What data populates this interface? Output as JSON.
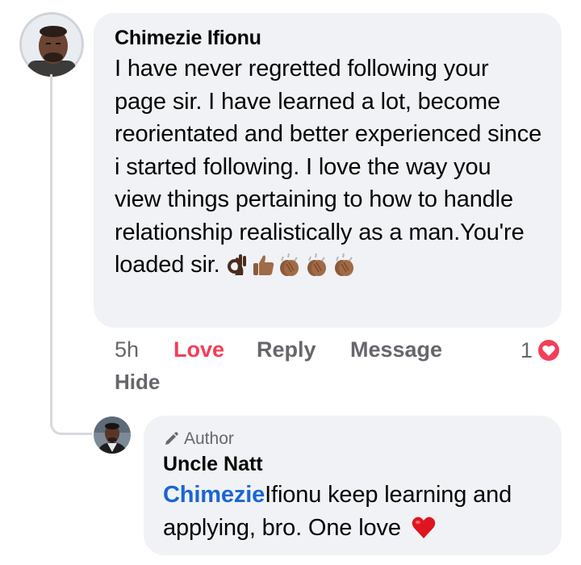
{
  "comment": {
    "author": "Chimezie Ifionu",
    "text": "I have never regretted following your page sir. I have learned a lot, become reorientated and better experienced since i started following. I love the way you view things pertaining to how to handle relationship realistically as a man.You're loaded sir.",
    "emojis": [
      "ok-hand-emoji",
      "thumbs-up-emoji",
      "clapping-hands-emoji",
      "clapping-hands-emoji",
      "clapping-hands-emoji"
    ],
    "time": "5h",
    "love_label": "Love",
    "reply_label": "Reply",
    "message_label": "Message",
    "reaction_count": "1",
    "hide_label": "Hide"
  },
  "reply": {
    "badge": "Author",
    "author": "Uncle Natt",
    "mention": "Chimezie",
    "text": "Ifionu keep learning and applying, bro. One love"
  },
  "colors": {
    "bubble": "#f0f2f5",
    "love": "#f33e58",
    "mention": "#1a65d6",
    "muted": "#65676b"
  }
}
